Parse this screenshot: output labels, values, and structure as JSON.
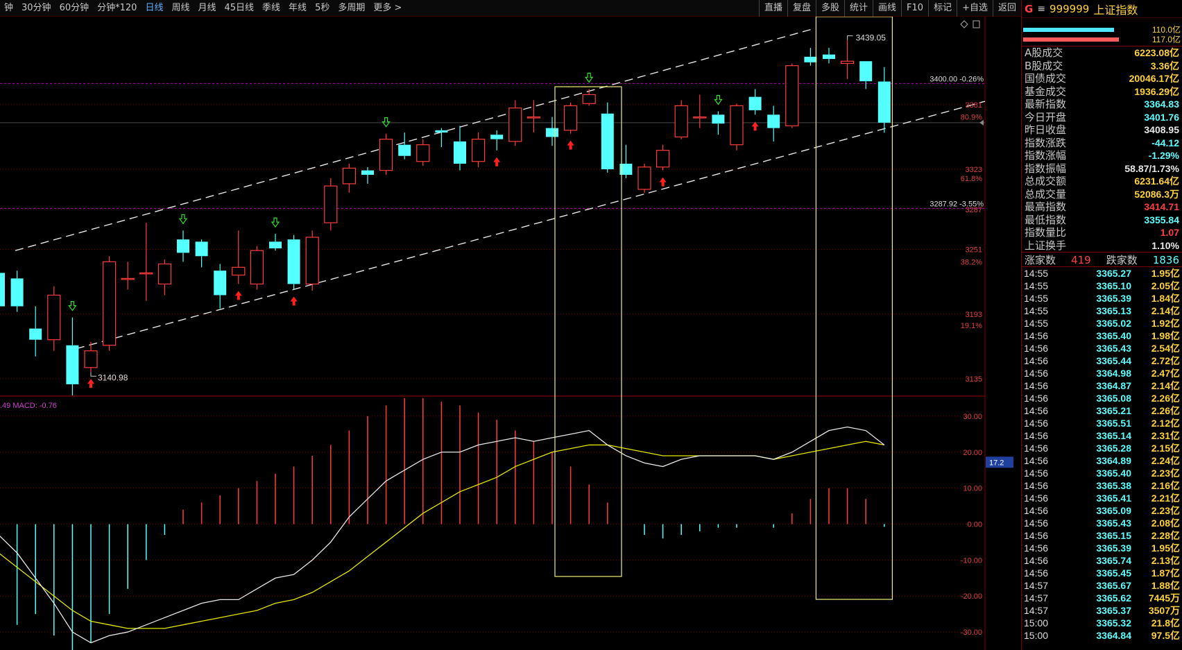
{
  "periods": [
    {
      "label": "钟",
      "active": false
    },
    {
      "label": "30分钟",
      "active": false
    },
    {
      "label": "60分钟",
      "active": false
    },
    {
      "label": "分钟*120",
      "active": false
    },
    {
      "label": "日线",
      "active": true
    },
    {
      "label": "周线",
      "active": false
    },
    {
      "label": "月线",
      "active": false
    },
    {
      "label": "45日线",
      "active": false
    },
    {
      "label": "季线",
      "active": false
    },
    {
      "label": "年线",
      "active": false
    },
    {
      "label": "5秒",
      "active": false
    },
    {
      "label": "多周期",
      "active": false
    },
    {
      "label": "更多 >",
      "active": false
    }
  ],
  "tools": [
    "直播",
    "复盘",
    "多股",
    "统计",
    "画线",
    "F10",
    "标记",
    "+自选",
    "返回"
  ],
  "colors": {
    "up": "#ff3c3c",
    "down": "#54ffff",
    "dif": "#e8e8e8",
    "dea": "#e6e600",
    "channel": "#e8e8e8",
    "highlight": "#f0f07a",
    "gridRed": "#7a0000",
    "magenta": "#c000c0"
  },
  "price_axis": {
    "ticks": [
      {
        "v": 3381,
        "label": "3381"
      },
      {
        "v": 3323,
        "label": "3323"
      },
      {
        "v": 3287,
        "label": "3287"
      },
      {
        "v": 3251,
        "label": "3251"
      },
      {
        "v": 3193,
        "label": "3193"
      },
      {
        "v": 3135,
        "label": "3135"
      }
    ],
    "fib": [
      {
        "v": 3370,
        "label": "80.9%"
      },
      {
        "v": 3315,
        "label": "61.8%"
      },
      {
        "v": 3240,
        "label": "38.2%"
      },
      {
        "v": 3183,
        "label": "19.1%"
      }
    ],
    "range": [
      3120,
      3460
    ],
    "current_price": 3364.83
  },
  "ref_lines": [
    {
      "v": 3400,
      "label": "3400.00 -0.26%"
    },
    {
      "v": 3287.92,
      "label": "3287.92 -3.55%"
    }
  ],
  "extremes": {
    "high_label": "3439.05",
    "low_label": "3140.98"
  },
  "macd_label": ".49  MACD: -0.76",
  "macd_axis": {
    "ticks": [
      "30.00",
      "20.00",
      "10.00",
      "0.00",
      "-10.00",
      "-20.00",
      "-30.00"
    ],
    "range": [
      -35,
      35
    ],
    "marker": "17.2"
  },
  "chart_data": {
    "type": "candlestick",
    "candles": [
      {
        "o": 3230,
        "c": 3200,
        "h": 3245,
        "l": 3190
      },
      {
        "o": 3225,
        "c": 3200,
        "h": 3232,
        "l": 3195
      },
      {
        "o": 3180,
        "c": 3170,
        "h": 3200,
        "l": 3155
      },
      {
        "o": 3170,
        "c": 3210,
        "h": 3218,
        "l": 3160
      },
      {
        "o": 3165,
        "c": 3130,
        "h": 3190,
        "l": 3120
      },
      {
        "o": 3145,
        "c": 3160,
        "h": 3168,
        "l": 3140.98
      },
      {
        "o": 3165,
        "c": 3240,
        "h": 3245,
        "l": 3160
      },
      {
        "o": 3225,
        "c": 3225,
        "h": 3240,
        "l": 3215
      },
      {
        "o": 3230,
        "c": 3230,
        "h": 3275,
        "l": 3205
      },
      {
        "o": 3220,
        "c": 3238,
        "h": 3242,
        "l": 3210
      },
      {
        "o": 3260,
        "c": 3248,
        "h": 3268,
        "l": 3240
      },
      {
        "o": 3258,
        "c": 3245,
        "h": 3260,
        "l": 3235
      },
      {
        "o": 3232,
        "c": 3210,
        "h": 3238,
        "l": 3198
      },
      {
        "o": 3228,
        "c": 3235,
        "h": 3268,
        "l": 3220
      },
      {
        "o": 3220,
        "c": 3250,
        "h": 3254,
        "l": 3215
      },
      {
        "o": 3258,
        "c": 3252,
        "h": 3265,
        "l": 3250
      },
      {
        "o": 3260,
        "c": 3220,
        "h": 3264,
        "l": 3215
      },
      {
        "o": 3220,
        "c": 3262,
        "h": 3268,
        "l": 3214
      },
      {
        "o": 3275,
        "c": 3308,
        "h": 3315,
        "l": 3268
      },
      {
        "o": 3310,
        "c": 3324,
        "h": 3328,
        "l": 3302
      },
      {
        "o": 3322,
        "c": 3318,
        "h": 3325,
        "l": 3310
      },
      {
        "o": 3322,
        "c": 3350,
        "h": 3355,
        "l": 3318
      },
      {
        "o": 3345,
        "c": 3335,
        "h": 3356,
        "l": 3332
      },
      {
        "o": 3330,
        "c": 3345,
        "h": 3350,
        "l": 3326
      },
      {
        "o": 3358,
        "c": 3356,
        "h": 3360,
        "l": 3343
      },
      {
        "o": 3348,
        "c": 3328,
        "h": 3362,
        "l": 3322
      },
      {
        "o": 3330,
        "c": 3350,
        "h": 3356,
        "l": 3325
      },
      {
        "o": 3354,
        "c": 3350,
        "h": 3358,
        "l": 3340
      },
      {
        "o": 3348,
        "c": 3378,
        "h": 3385,
        "l": 3344
      },
      {
        "o": 3370,
        "c": 3370,
        "h": 3385,
        "l": 3356
      },
      {
        "o": 3360,
        "c": 3352,
        "h": 3370,
        "l": 3344
      },
      {
        "o": 3358,
        "c": 3380,
        "h": 3383,
        "l": 3355
      },
      {
        "o": 3382,
        "c": 3390,
        "h": 3395,
        "l": 3380
      },
      {
        "o": 3373,
        "c": 3323,
        "h": 3383,
        "l": 3320
      },
      {
        "o": 3328,
        "c": 3318,
        "h": 3345,
        "l": 3315
      },
      {
        "o": 3305,
        "c": 3325,
        "h": 3328,
        "l": 3302
      },
      {
        "o": 3325,
        "c": 3340,
        "h": 3345,
        "l": 3322
      },
      {
        "o": 3352,
        "c": 3380,
        "h": 3385,
        "l": 3350
      },
      {
        "o": 3370,
        "c": 3370,
        "h": 3390,
        "l": 3360
      },
      {
        "o": 3372,
        "c": 3364,
        "h": 3375,
        "l": 3354
      },
      {
        "o": 3345,
        "c": 3380,
        "h": 3382,
        "l": 3340
      },
      {
        "o": 3388,
        "c": 3376,
        "h": 3395,
        "l": 3372
      },
      {
        "o": 3372,
        "c": 3360,
        "h": 3380,
        "l": 3348
      },
      {
        "o": 3362,
        "c": 3416,
        "h": 3418,
        "l": 3360
      },
      {
        "o": 3424,
        "c": 3419,
        "h": 3432,
        "l": 3416
      },
      {
        "o": 3426,
        "c": 3422,
        "h": 3432,
        "l": 3418
      },
      {
        "o": 3418,
        "c": 3420,
        "h": 3439.05,
        "l": 3404
      },
      {
        "o": 3420,
        "c": 3402,
        "h": 3420,
        "l": 3395
      },
      {
        "o": 3401.76,
        "c": 3364.83,
        "h": 3414.71,
        "l": 3355.84
      }
    ],
    "macd_hist": [
      -30,
      -28,
      -25,
      -31,
      -35,
      -33,
      -25,
      -18,
      -10,
      -3,
      4,
      6,
      8,
      10,
      12,
      14,
      16,
      19,
      22,
      26,
      30,
      33,
      35,
      35,
      34,
      33,
      31,
      29,
      26,
      23,
      20,
      16,
      11,
      6,
      0,
      -3,
      -4,
      -3,
      -2,
      -1,
      -1,
      0,
      -1,
      3,
      7,
      10,
      10,
      7,
      -0.76
    ],
    "dif": [
      -3,
      -8,
      -15,
      -22,
      -30,
      -33,
      -31,
      -30,
      -28,
      -26,
      -24,
      -22,
      -21,
      -21,
      -18,
      -15,
      -14,
      -10,
      -5,
      2,
      7,
      12,
      15,
      18,
      20,
      20,
      22,
      23,
      24,
      23,
      24,
      25,
      26,
      22,
      19,
      17,
      16,
      18,
      19,
      19,
      19,
      19,
      18,
      20,
      23,
      26,
      27,
      26,
      22
    ],
    "dea": [
      -8,
      -12,
      -16,
      -20,
      -24,
      -27,
      -28,
      -29,
      -29,
      -29,
      -28,
      -27,
      -26,
      -25,
      -24,
      -22,
      -21,
      -19,
      -16,
      -13,
      -9,
      -5,
      -1,
      3,
      6,
      9,
      11,
      13,
      16,
      18,
      20,
      21,
      22,
      22,
      21,
      20,
      19,
      19,
      19,
      19,
      19,
      19,
      18,
      19,
      20,
      21,
      22,
      23,
      22
    ]
  },
  "side": {
    "badge": "G",
    "menu_icon": "≡",
    "code": "999999",
    "name": "上证指数",
    "bars": [
      {
        "value": "110.0亿",
        "color": "#4de8ff",
        "fill": 0.82
      },
      {
        "value": "117.0亿",
        "color": "#ff5a5a",
        "fill": 0.86
      }
    ],
    "stats": [
      {
        "label": "A股成交",
        "value": "6223.08亿",
        "color": "#ffd23a"
      },
      {
        "label": "B股成交",
        "value": "3.36亿",
        "color": "#ffd23a"
      },
      {
        "label": "国债成交",
        "value": "20046.17亿",
        "color": "#ffd23a"
      },
      {
        "label": "基金成交",
        "value": "1936.29亿",
        "color": "#ffd23a"
      },
      {
        "label": "最新指数",
        "value": "3364.83",
        "color": "#5fffff"
      },
      {
        "label": "今日开盘",
        "value": "3401.76",
        "color": "#5fffff"
      },
      {
        "label": "昨日收盘",
        "value": "3408.95",
        "color": "#e8e8e8"
      },
      {
        "label": "指数涨跌",
        "value": "-44.12",
        "color": "#5fffff"
      },
      {
        "label": "指数涨幅",
        "value": "-1.29%",
        "color": "#5fffff"
      },
      {
        "label": "指数振幅",
        "value": "58.87/1.73%",
        "color": "#e8e8e8"
      },
      {
        "label": "总成交额",
        "value": "6231.64亿",
        "color": "#ffd23a"
      },
      {
        "label": "总成交量",
        "value": "52086.3万",
        "color": "#ffd23a"
      },
      {
        "label": "最高指数",
        "value": "3414.71",
        "color": "#ff4040"
      },
      {
        "label": "最低指数",
        "value": "3355.84",
        "color": "#5fffff"
      },
      {
        "label": "指数量比",
        "value": "1.07",
        "color": "#ff4040"
      },
      {
        "label": "上证换手",
        "value": "1.10%",
        "color": "#e8e8e8"
      }
    ],
    "updown": {
      "up_label": "涨家数",
      "up": "419",
      "down_label": "跌家数",
      "down": "1836"
    },
    "ticks": [
      {
        "t": "14:55",
        "p": "3365.27",
        "v": "1.95亿"
      },
      {
        "t": "14:55",
        "p": "3365.10",
        "v": "2.05亿"
      },
      {
        "t": "14:55",
        "p": "3365.39",
        "v": "1.84亿"
      },
      {
        "t": "14:55",
        "p": "3365.13",
        "v": "2.14亿"
      },
      {
        "t": "14:55",
        "p": "3365.02",
        "v": "1.92亿"
      },
      {
        "t": "14:56",
        "p": "3365.40",
        "v": "1.98亿"
      },
      {
        "t": "14:56",
        "p": "3365.43",
        "v": "2.54亿"
      },
      {
        "t": "14:56",
        "p": "3365.44",
        "v": "2.72亿"
      },
      {
        "t": "14:56",
        "p": "3364.98",
        "v": "2.47亿"
      },
      {
        "t": "14:56",
        "p": "3364.87",
        "v": "2.14亿"
      },
      {
        "t": "14:56",
        "p": "3365.08",
        "v": "2.26亿"
      },
      {
        "t": "14:56",
        "p": "3365.21",
        "v": "2.26亿"
      },
      {
        "t": "14:56",
        "p": "3365.51",
        "v": "2.12亿"
      },
      {
        "t": "14:56",
        "p": "3365.14",
        "v": "2.31亿"
      },
      {
        "t": "14:56",
        "p": "3365.28",
        "v": "2.15亿"
      },
      {
        "t": "14:56",
        "p": "3364.89",
        "v": "2.24亿"
      },
      {
        "t": "14:56",
        "p": "3365.40",
        "v": "2.23亿"
      },
      {
        "t": "14:56",
        "p": "3365.38",
        "v": "2.16亿"
      },
      {
        "t": "14:56",
        "p": "3365.41",
        "v": "2.21亿"
      },
      {
        "t": "14:56",
        "p": "3365.09",
        "v": "2.23亿"
      },
      {
        "t": "14:56",
        "p": "3365.43",
        "v": "2.08亿"
      },
      {
        "t": "14:56",
        "p": "3365.15",
        "v": "2.28亿"
      },
      {
        "t": "14:56",
        "p": "3365.39",
        "v": "1.95亿"
      },
      {
        "t": "14:56",
        "p": "3365.74",
        "v": "2.13亿"
      },
      {
        "t": "14:56",
        "p": "3365.45",
        "v": "1.87亿"
      },
      {
        "t": "14:57",
        "p": "3365.67",
        "v": "1.88亿"
      },
      {
        "t": "14:57",
        "p": "3365.62",
        "v": "7445万"
      },
      {
        "t": "14:57",
        "p": "3365.37",
        "v": "3507万"
      },
      {
        "t": "15:00",
        "p": "3365.32",
        "v": "21.8亿"
      },
      {
        "t": "15:00",
        "p": "3364.84",
        "v": "97.5亿"
      }
    ]
  }
}
